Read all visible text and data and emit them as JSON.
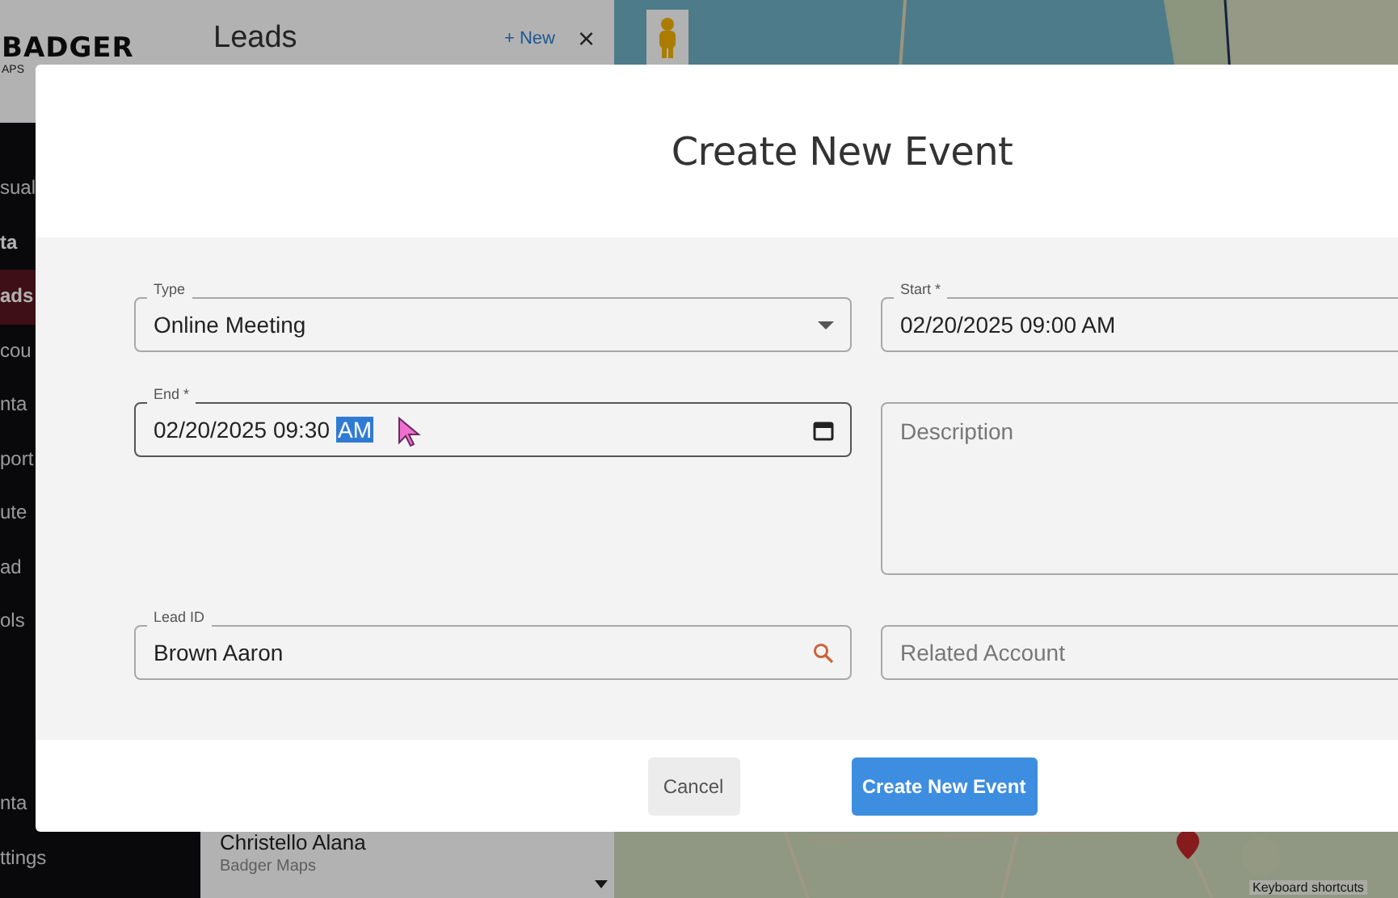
{
  "sidebar": {
    "logo": "BADGER",
    "logo_sub": "APS",
    "nav": [
      {
        "label": "sual",
        "kind": "item",
        "selected": false
      },
      {
        "label": "ta",
        "kind": "header",
        "selected": false
      },
      {
        "label": "ads",
        "kind": "item",
        "selected": true
      },
      {
        "label": "cou",
        "kind": "item",
        "selected": false
      },
      {
        "label": "nta",
        "kind": "item",
        "selected": false
      },
      {
        "label": "port",
        "kind": "item",
        "selected": false
      },
      {
        "label": "ute",
        "kind": "item",
        "selected": false
      },
      {
        "label": "ad",
        "kind": "item",
        "selected": false
      },
      {
        "label": "ols",
        "kind": "item",
        "selected": false
      }
    ],
    "bottom_nav": [
      {
        "label": "nta",
        "selected": false
      },
      {
        "label": "ttings",
        "selected": false
      }
    ]
  },
  "leads_panel": {
    "title": "Leads",
    "new_button": "+ New",
    "close": "×",
    "items": [
      {
        "name": "Christello Alana",
        "company": "Badger Maps"
      }
    ]
  },
  "map": {
    "keyboard_shortcuts": "Keyboard shortcuts"
  },
  "dialog": {
    "title": "Create New Event",
    "fields": [
      {
        "kind": "select",
        "label": "Type",
        "value": "Online Meeting",
        "focused": false
      },
      {
        "kind": "datetime",
        "label": "Start *",
        "value": "02/20/2025 09:00 AM",
        "focused": false
      },
      {
        "kind": "datetime_picker",
        "label": "End *",
        "value": "02/20/2025 09:30",
        "selected_part": "AM",
        "focused": true
      },
      {
        "kind": "textarea",
        "placeholder": "Description",
        "focused": false
      },
      {
        "kind": "search",
        "label": "Lead ID",
        "value": "Brown Aaron",
        "focused": false
      },
      {
        "kind": "text",
        "placeholder": "Related Account",
        "focused": false
      }
    ],
    "buttons": [
      {
        "label": "Cancel",
        "kind": "secondary"
      },
      {
        "label": "Create New Event",
        "kind": "primary"
      }
    ]
  }
}
